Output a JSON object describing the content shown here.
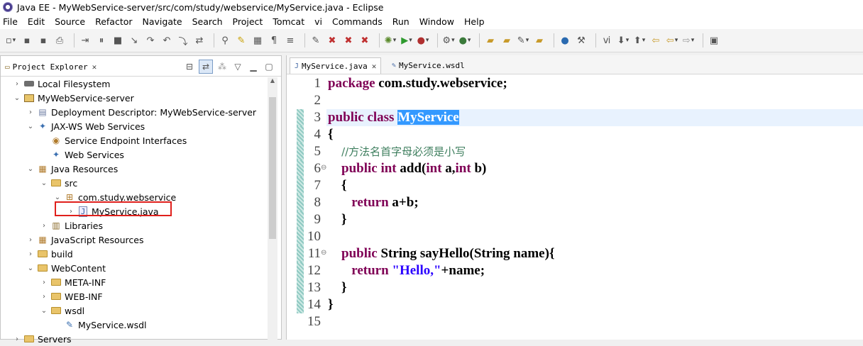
{
  "window": {
    "title": "Java EE - MyWebService-server/src/com/study/webservice/MyService.java - Eclipse"
  },
  "menu": [
    "File",
    "Edit",
    "Source",
    "Refactor",
    "Navigate",
    "Search",
    "Project",
    "Tomcat",
    "vi",
    "Commands",
    "Run",
    "Window",
    "Help"
  ],
  "project_explorer": {
    "tab_label": "Project Explorer",
    "items": [
      {
        "label": "Local Filesystem",
        "indent": 0,
        "arrow": "›",
        "icon": "drive"
      },
      {
        "label": "MyWebService-server",
        "indent": 0,
        "arrow": "⌄",
        "icon": "project"
      },
      {
        "label": "Deployment Descriptor: MyWebService-server",
        "indent": 1,
        "arrow": "›",
        "icon": "descriptor"
      },
      {
        "label": "JAX-WS Web Services",
        "indent": 1,
        "arrow": "⌄",
        "icon": "jaxws"
      },
      {
        "label": "Service Endpoint Interfaces",
        "indent": 2,
        "arrow": "",
        "icon": "sei"
      },
      {
        "label": "Web Services",
        "indent": 2,
        "arrow": "",
        "icon": "ws"
      },
      {
        "label": "Java Resources",
        "indent": 1,
        "arrow": "⌄",
        "icon": "javares"
      },
      {
        "label": "src",
        "indent": 2,
        "arrow": "⌄",
        "icon": "srcfolder"
      },
      {
        "label": "com.study.webservice",
        "indent": 3,
        "arrow": "⌄",
        "icon": "package"
      },
      {
        "label": "MyService.java",
        "indent": 4,
        "arrow": "›",
        "icon": "javafile"
      },
      {
        "label": "Libraries",
        "indent": 2,
        "arrow": "›",
        "icon": "libs"
      },
      {
        "label": "JavaScript Resources",
        "indent": 1,
        "arrow": "›",
        "icon": "jsres"
      },
      {
        "label": "build",
        "indent": 1,
        "arrow": "›",
        "icon": "folder"
      },
      {
        "label": "WebContent",
        "indent": 1,
        "arrow": "⌄",
        "icon": "folder"
      },
      {
        "label": "META-INF",
        "indent": 2,
        "arrow": "›",
        "icon": "folder"
      },
      {
        "label": "WEB-INF",
        "indent": 2,
        "arrow": "›",
        "icon": "folder"
      },
      {
        "label": "wsdl",
        "indent": 2,
        "arrow": "⌄",
        "icon": "folder"
      },
      {
        "label": "MyService.wsdl",
        "indent": 3,
        "arrow": "",
        "icon": "wsdlfile"
      },
      {
        "label": "Servers",
        "indent": 0,
        "arrow": "›",
        "icon": "folder"
      }
    ]
  },
  "editor": {
    "tabs": [
      {
        "label": "MyService.java",
        "active": true
      },
      {
        "label": "MyService.wsdl",
        "active": false
      }
    ],
    "lines": [
      {
        "n": "1",
        "parts": [
          [
            "kw",
            "package"
          ],
          [
            "b",
            " com.study.webservice;"
          ]
        ]
      },
      {
        "n": "2",
        "parts": []
      },
      {
        "n": "3",
        "parts": [
          [
            "kw",
            "public class "
          ],
          [
            "sel",
            "MyService"
          ]
        ],
        "highlight": true
      },
      {
        "n": "4",
        "parts": [
          [
            "b",
            "{"
          ]
        ]
      },
      {
        "n": "5",
        "parts": [
          [
            "cm",
            "    //方法名首字母必须是小写"
          ]
        ]
      },
      {
        "n": "6",
        "parts": [
          [
            "b",
            "    "
          ],
          [
            "kw",
            "public int"
          ],
          [
            "b",
            " add("
          ],
          [
            "kw",
            "int"
          ],
          [
            "b",
            " a,"
          ],
          [
            "kw",
            "int"
          ],
          [
            "b",
            " b)"
          ]
        ],
        "fold": true
      },
      {
        "n": "7",
        "parts": [
          [
            "b",
            "    {"
          ]
        ]
      },
      {
        "n": "8",
        "parts": [
          [
            "b",
            "       "
          ],
          [
            "kw",
            "return"
          ],
          [
            "b",
            " a+b;"
          ]
        ]
      },
      {
        "n": "9",
        "parts": [
          [
            "b",
            "    }"
          ]
        ]
      },
      {
        "n": "10",
        "parts": []
      },
      {
        "n": "11",
        "parts": [
          [
            "b",
            "    "
          ],
          [
            "kw",
            "public"
          ],
          [
            "b",
            " String sayHello(String name){"
          ]
        ],
        "fold": true
      },
      {
        "n": "12",
        "parts": [
          [
            "b",
            "       "
          ],
          [
            "kw",
            "return"
          ],
          [
            "b",
            " "
          ],
          [
            "str",
            "\"Hello,\""
          ],
          [
            "b",
            "+name;"
          ]
        ]
      },
      {
        "n": "13",
        "parts": [
          [
            "b",
            "    }"
          ]
        ]
      },
      {
        "n": "14",
        "parts": [
          [
            "b",
            "}"
          ]
        ]
      },
      {
        "n": "15",
        "parts": []
      }
    ]
  }
}
